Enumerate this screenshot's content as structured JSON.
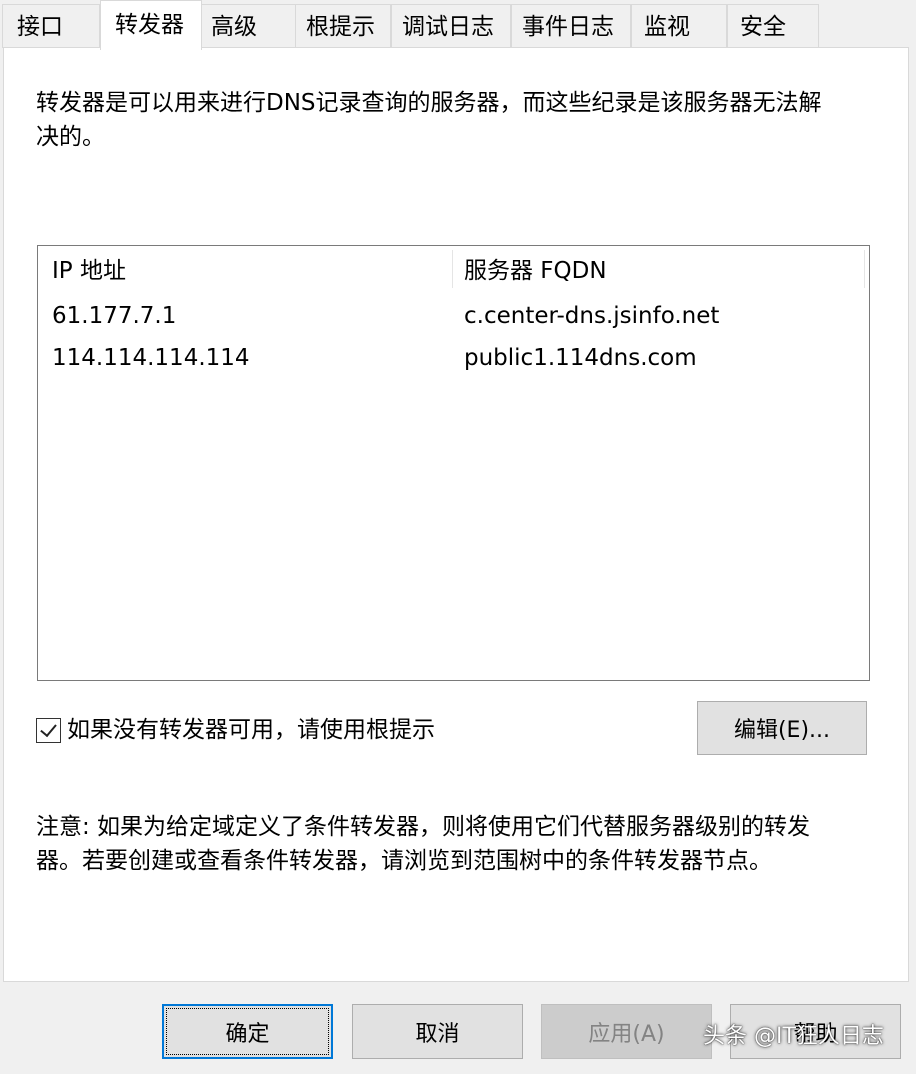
{
  "tabs": [
    {
      "label": "接口"
    },
    {
      "label": "转发器"
    },
    {
      "label": "高级"
    },
    {
      "label": "根提示"
    },
    {
      "label": "调试日志"
    },
    {
      "label": "事件日志"
    },
    {
      "label": "监视"
    },
    {
      "label": "安全"
    }
  ],
  "active_tab": "转发器",
  "description": {
    "line1": "转发器是可以用来进行DNS记录查询的服务器，而这些纪录是该服务器无法解",
    "line2": "决的。"
  },
  "forwarders_list": {
    "columns": [
      "IP 地址",
      "服务器 FQDN"
    ],
    "rows": [
      {
        "ip": "61.177.7.1",
        "fqdn": "c.center-dns.jsinfo.net"
      },
      {
        "ip": "114.114.114.114",
        "fqdn": "public1.114dns.com"
      }
    ]
  },
  "use_root_hints": {
    "checked": true,
    "label": "如果没有转发器可用，请使用根提示"
  },
  "edit_button": "编辑(E)...",
  "note": {
    "line1": "注意: 如果为给定域定义了条件转发器，则将使用它们代替服务器级别的转发",
    "line2": "器。若要创建或查看条件转发器，请浏览到范围树中的条件转发器节点。"
  },
  "footer": {
    "ok": "确定",
    "cancel": "取消",
    "apply": "应用(A)",
    "help": "帮助"
  },
  "watermark": "头条 @IT狂人日志",
  "colors": {
    "focus_border": "#0078d7",
    "panel_bg": "#ffffff",
    "dialog_bg": "#f0f0f0"
  }
}
